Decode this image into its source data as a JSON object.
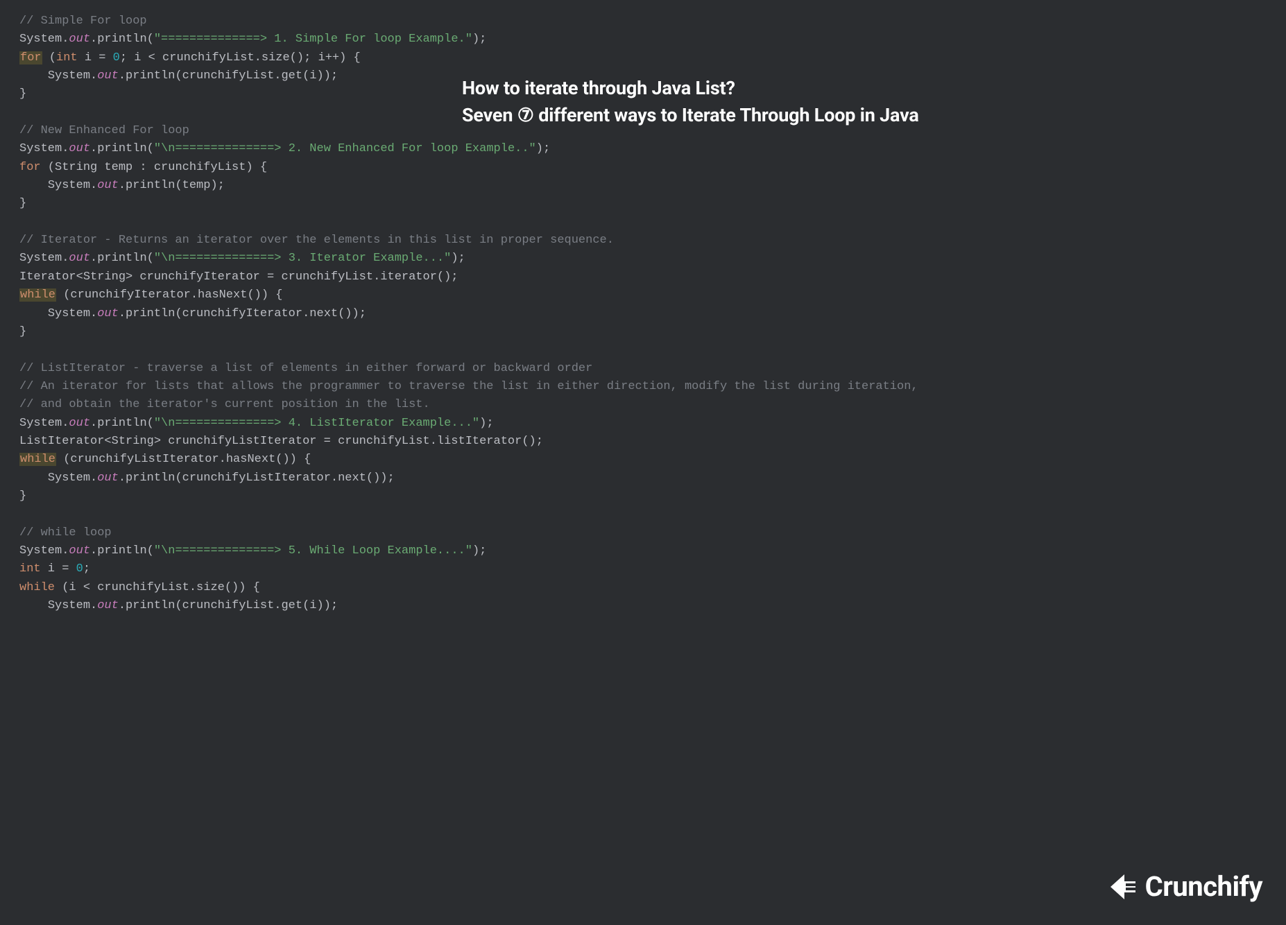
{
  "overlay": {
    "line1": "How to iterate through Java List?",
    "line2_prefix": "Seven ",
    "line2_badge": "⑦",
    "line2_suffix": " different ways to Iterate Through Loop in Java"
  },
  "logo_text": "Crunchify",
  "code": {
    "b1_comment": "// Simple For loop",
    "b1_str": "\"==============> 1. Simple For loop Example.\"",
    "b1_for_int": "int",
    "b1_for_init": " i = ",
    "b1_for_zero": "0",
    "b1_for_cond": "; i < crunchifyList.size(); i++) {",
    "b1_body": ".println(crunchifyList.get(i));",
    "b2_comment": "// New Enhanced For loop",
    "b2_str": "\"\\n==============> 2. New Enhanced For loop Example..\"",
    "b2_for": " (String temp : crunchifyList) {",
    "b2_body": ".println(temp);",
    "b3_comment": "// Iterator - Returns an iterator over the elements in this list in proper sequence.",
    "b3_str": "\"\\n==============> 3. Iterator Example...\"",
    "b3_decl": "Iterator<String> crunchifyIterator = crunchifyList.iterator();",
    "b3_while": " (crunchifyIterator.hasNext()) {",
    "b3_body": ".println(crunchifyIterator.next());",
    "b4_comment1": "// ListIterator - traverse a list of elements in either forward or backward order",
    "b4_comment2": "// An iterator for lists that allows the programmer to traverse the list in either direction, modify the list during iteration,",
    "b4_comment3": "// and obtain the iterator's current position in the list.",
    "b4_str": "\"\\n==============> 4. ListIterator Example...\"",
    "b4_decl": "ListIterator<String> crunchifyListIterator = crunchifyList.listIterator();",
    "b4_while": " (crunchifyListIterator.hasNext()) {",
    "b4_body": ".println(crunchifyListIterator.next());",
    "b5_comment": "// while loop",
    "b5_str": "\"\\n==============> 5. While Loop Example....\"",
    "b5_int": "int",
    "b5_init": " i = ",
    "b5_zero": "0",
    "b5_semi": ";",
    "b5_while": " (i < crunchifyList.size()) {",
    "b5_body": ".println(crunchifyList.get(i));",
    "tok_system": "System",
    "tok_out": "out",
    "tok_println": ".println(",
    "tok_close_stmt": ");",
    "tok_for": "for",
    "tok_while": "while",
    "tok_lparen": " (",
    "tok_brace_close": "}",
    "tok_dot": ".",
    "tok_indent": "    ",
    "tok_guide": "|"
  }
}
